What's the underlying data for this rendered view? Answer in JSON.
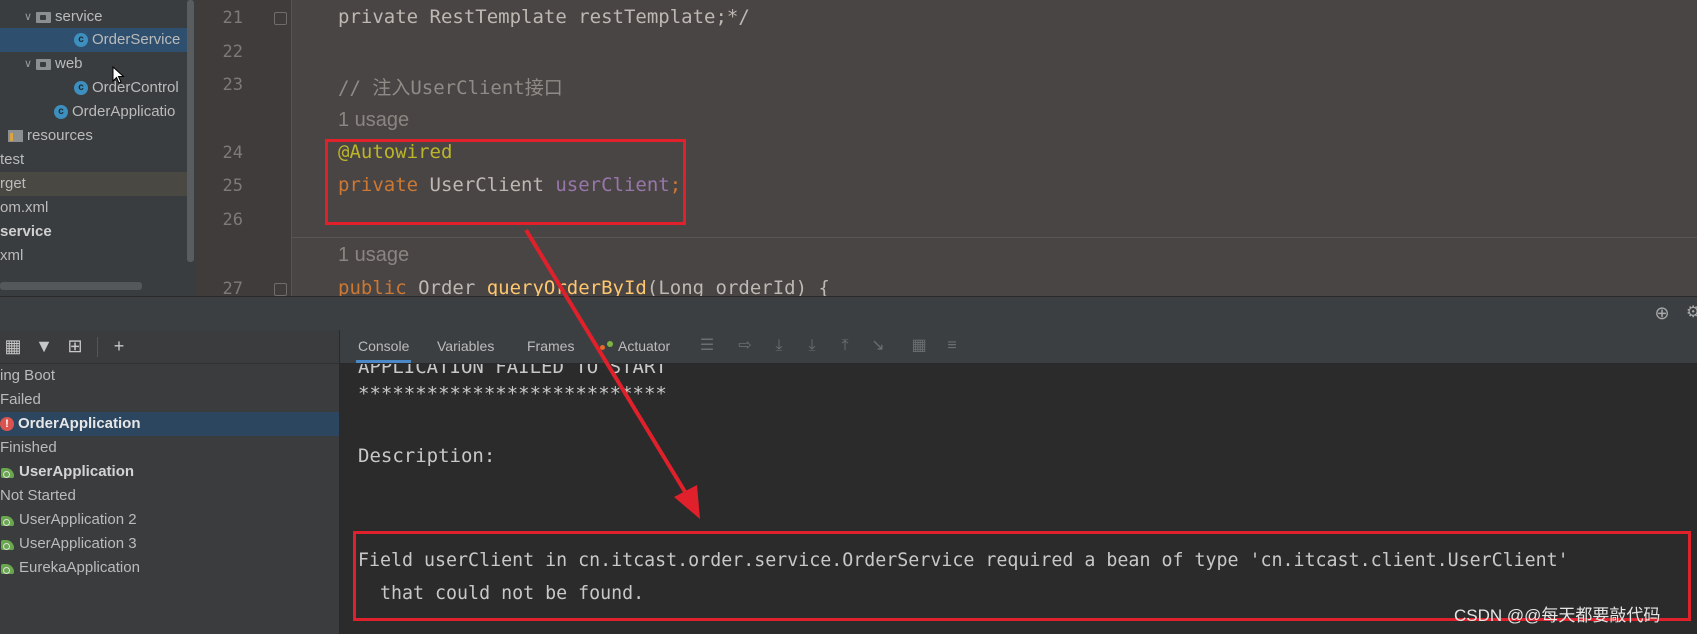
{
  "project_tree": {
    "items": [
      {
        "label": "service",
        "type": "package"
      },
      {
        "label": "OrderService",
        "type": "class"
      },
      {
        "label": "web",
        "type": "package"
      },
      {
        "label": "OrderControl",
        "type": "class"
      },
      {
        "label": "OrderApplicatio",
        "type": "app"
      },
      {
        "label": "resources",
        "type": "resources"
      },
      {
        "label": "test",
        "type": "folder"
      },
      {
        "label": "rget",
        "type": "folder"
      },
      {
        "label": "om.xml",
        "type": "file"
      },
      {
        "label": "service",
        "type": "module"
      },
      {
        "label": "xml",
        "type": "file"
      }
    ]
  },
  "editor": {
    "line_numbers": [
      "21",
      "22",
      "23",
      "24",
      "25",
      "26",
      "27"
    ],
    "line21": {
      "text": "private RestTemplate restTemplate;*/"
    },
    "line23": {
      "text": "// 注入UserClient接口"
    },
    "usage_label": "1 usage",
    "line24": {
      "annotation": "@Autowired"
    },
    "line25": {
      "kw": "private",
      "type": " UserClient ",
      "field": "userClient",
      "semi": ";"
    },
    "line27": {
      "kw": "public",
      "type": " Order ",
      "method": "queryOrderById",
      "params": "(Long orderId) {"
    }
  },
  "services": {
    "groups": [
      {
        "label": "ing Boot",
        "kind": "group"
      },
      {
        "label": "Failed",
        "kind": "status"
      },
      {
        "label": "OrderApplication",
        "kind": "app-error",
        "selected": true
      },
      {
        "label": "Finished",
        "kind": "status"
      },
      {
        "label": "UserApplication",
        "kind": "app-boot",
        "bold": true
      },
      {
        "label": "Not Started",
        "kind": "status"
      },
      {
        "label": "UserApplication 2",
        "kind": "app-boot"
      },
      {
        "label": "UserApplication 3",
        "kind": "app-boot"
      },
      {
        "label": "EurekaApplication",
        "kind": "app-boot"
      }
    ]
  },
  "console": {
    "tabs": [
      {
        "label": "Console",
        "active": true
      },
      {
        "label": "Variables"
      },
      {
        "label": "Frames"
      },
      {
        "label": "Actuator"
      }
    ],
    "lines": [
      "APPLICATION FAILED TO START",
      "***************************",
      "",
      "Description:",
      "",
      "Field userClient in cn.itcast.order.service.OrderService required a bean of type 'cn.itcast.client.UserClient'",
      "  that could not be found."
    ]
  },
  "watermark": "CSDN @@每天都要敲代码",
  "colors": {
    "annotation_box": "#e0202a",
    "keyword": "#cc7832",
    "annotation": "#bbb529",
    "field": "#9876aa",
    "method": "#ffc66d"
  }
}
